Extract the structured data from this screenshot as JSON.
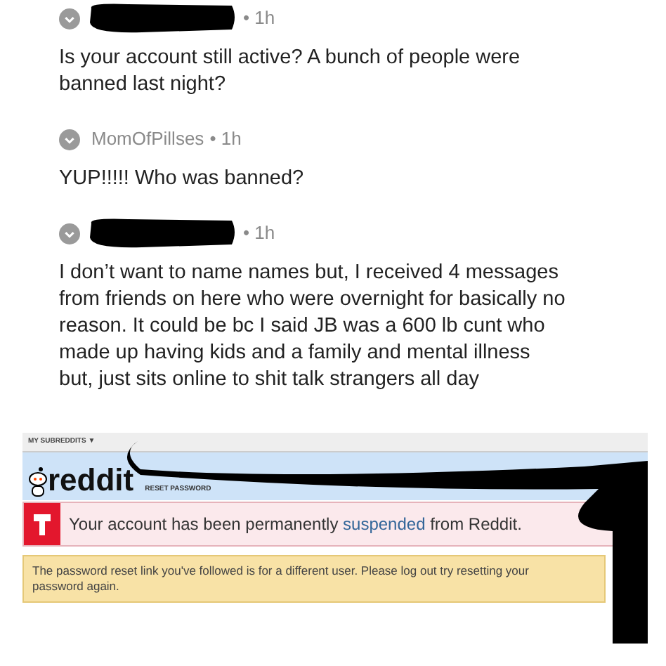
{
  "comments": [
    {
      "redacted": true,
      "time": "• 1h",
      "body": "Is your account still active? A bunch of people were banned last night?"
    },
    {
      "redacted": false,
      "author": "MomOfPillses",
      "time": "• 1h",
      "body": "YUP!!!!! Who was banned?"
    },
    {
      "redacted": true,
      "time": "• 1h",
      "body": "I don’t want to name names but, I received 4 messages from friends on here who were overnight for basically no reason. It could be bc I said JB was a 600 lb cunt who made up having kids and a family and mental illness but, just sits online to shit talk strangers all day"
    }
  ],
  "reddit": {
    "subreddits_menu": "MY SUBREDDITS ▼",
    "logo": "reddit",
    "page_title": "RESET PASSWORD",
    "alert": {
      "before": "Your account has been permanently ",
      "link": "suspended",
      "after": " from Reddit."
    },
    "notice": "The password reset link you've followed is for a different user. Please log out try resetting your password again."
  }
}
